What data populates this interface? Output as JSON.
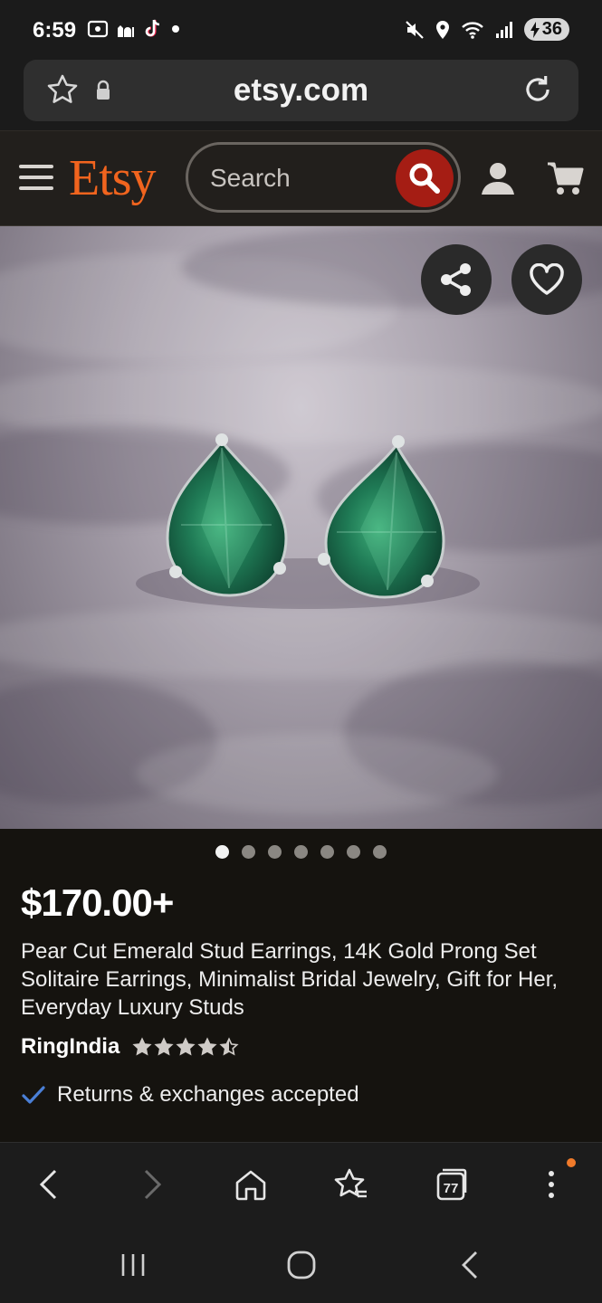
{
  "status_bar": {
    "time": "6:59",
    "battery": "36"
  },
  "browser": {
    "url": "etsy.com",
    "tabs_count": "77"
  },
  "header": {
    "logo": "Etsy",
    "search_placeholder": "Search"
  },
  "product": {
    "price": "$170.00+",
    "title": "Pear Cut Emerald Stud Earrings, 14K Gold Prong Set Solitaire Earrings, Minimalist Bridal Jewelry, Gift for Her, Everyday Luxury Studs",
    "shop_name": "RingIndia",
    "rating": 4.5,
    "returns_text": "Returns & exchanges accepted",
    "image_count": 7,
    "active_image": 1
  },
  "colors": {
    "brand": "#f1641e",
    "search_button": "#a51d14",
    "check": "#4a7fd6"
  }
}
